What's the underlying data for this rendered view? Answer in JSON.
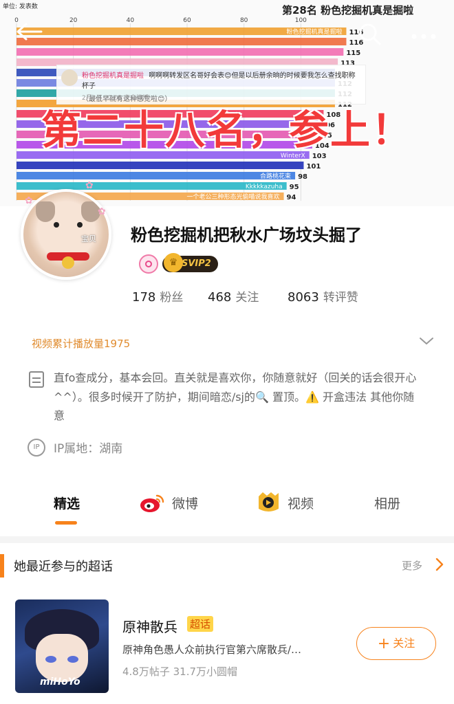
{
  "banner": {
    "unit_label": "单位: 发表数",
    "rank_title": "第28名  粉色挖掘机真是掘啦",
    "overlay_text": "第二十八名，参上！",
    "comment": {
      "name": "粉色挖掘机真是掘啦",
      "text": "啊啊啊转发区名哥好会表😊但是以后册余晌的时候要我怎么查找职称杯子",
      "line2": "（最低早就有这种感觉啦😊）",
      "time": "2月3日 22:05 来自微博"
    },
    "icons": {
      "back": "arrow-left-icon",
      "search": "search-icon",
      "more": "more-dots-icon"
    }
  },
  "chart_data": {
    "type": "bar",
    "orientation": "horizontal",
    "xlim": [
      0,
      120
    ],
    "x_ticks": [
      "0",
      "20",
      "40",
      "60",
      "80",
      "100"
    ],
    "bars": [
      {
        "label": "粉色挖掘机真是掘啦",
        "value": 116,
        "color": "#f0a030"
      },
      {
        "label": "",
        "value": 116,
        "color": "#ee6a3c"
      },
      {
        "label": "",
        "value": 115,
        "color": "#f26db0"
      },
      {
        "label": "",
        "value": 113,
        "color": "#f2b0c6"
      },
      {
        "label": "",
        "value": 112,
        "color": "#2a48b8"
      },
      {
        "label": "",
        "value": 112,
        "color": "#6b7cdf"
      },
      {
        "label": "",
        "value": 112,
        "color": "#1b9e9e"
      },
      {
        "label": "",
        "value": 112,
        "color": "#f29c2a"
      },
      {
        "label": "",
        "value": 108,
        "color": "#ef3a5c"
      },
      {
        "label": "",
        "value": 106,
        "color": "#8a58e8"
      },
      {
        "label": "",
        "value": 105,
        "color": "#e358b0"
      },
      {
        "label": "",
        "value": 104,
        "color": "#b046e8"
      },
      {
        "label": "WinterX",
        "value": 103,
        "color": "#8e5cf0"
      },
      {
        "label": "",
        "value": 101,
        "color": "#2030b8"
      },
      {
        "label": "合路桃花束",
        "value": 98,
        "color": "#3a7ae0"
      },
      {
        "label": "Kkkkkazuha",
        "value": 95,
        "color": "#27b7c7"
      },
      {
        "label": "一个老公三种形态光偷喵说我喜欢",
        "value": 94,
        "color": "#f4a64a"
      }
    ]
  },
  "profile": {
    "avatar_label": "宝贝",
    "name": "粉色挖掘机把秋水广场坟头掘了",
    "svip": "SVIP2",
    "fans_count": "178",
    "fans_label": "粉丝",
    "follow_count": "468",
    "follow_label": "关注",
    "react_count": "8063",
    "react_label": "转评赞",
    "video_plays": "视频累计播放量1975",
    "bio": "直fo查成分，基本会回。直关就是喜欢你，你随意就好（回关的话会很开心^^）。很多时候开了防护，期间暗恋/sj的🔍 置顶。⚠️ 开盒违法 其他你随意",
    "ip": "IP属地：湖南"
  },
  "tabs": [
    {
      "label": "精选",
      "active": true
    },
    {
      "label": "微博",
      "active": false
    },
    {
      "label": "视频",
      "active": false
    },
    {
      "label": "相册",
      "active": false
    }
  ],
  "section": {
    "title": "她最近参与的超话",
    "more": "更多",
    "topic": {
      "name": "原神散兵",
      "tag": "超话",
      "description": "原神角色愚人众前执行官第六席散兵/…",
      "stats": "4.8万帖子  31.7万小圆帽",
      "cover_logo": "miHoYo",
      "follow_label": "关注"
    }
  }
}
